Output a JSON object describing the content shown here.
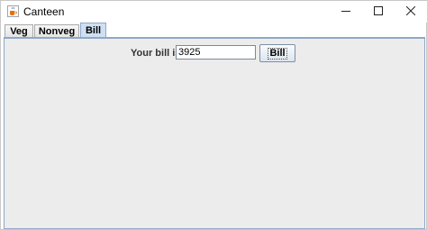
{
  "window": {
    "title": "Canteen"
  },
  "icons": {
    "app": "java-cup-icon",
    "minimize": "minimize-icon",
    "maximize": "maximize-icon",
    "close": "close-icon"
  },
  "tabs": [
    {
      "label": "Veg",
      "selected": false
    },
    {
      "label": "Nonveg",
      "selected": false
    },
    {
      "label": "Bill",
      "selected": true
    }
  ],
  "bill": {
    "label": "Your bill is",
    "value": "3925",
    "button_label": "Bill"
  }
}
